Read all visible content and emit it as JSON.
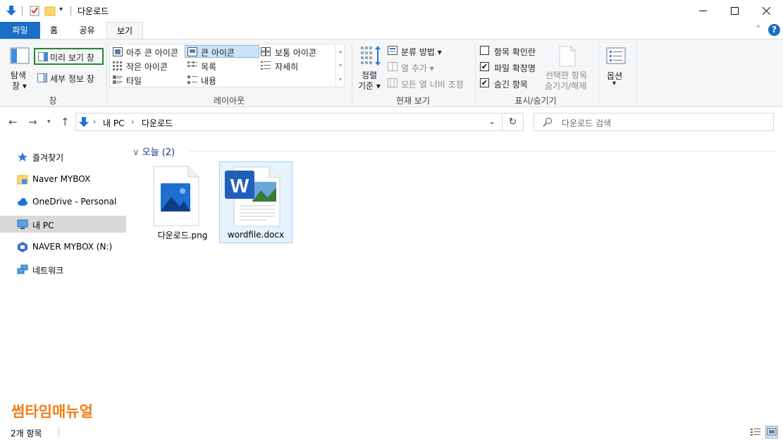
{
  "window": {
    "title": "다운로드"
  },
  "ribbon_tabs": [
    "파일",
    "홈",
    "공유",
    "보기"
  ],
  "ribbon": {
    "pane": {
      "nav_pane_label_1": "탐색",
      "nav_pane_label_2": "창 ▾",
      "preview_pane": "미리 보기 창",
      "details_pane": "세부 정보 창",
      "group_label": "창"
    },
    "layout": {
      "items": [
        "아주 큰 아이콘",
        "큰 아이콘",
        "보통 아이콘",
        "작은 아이콘",
        "목록",
        "자세히",
        "타일",
        "내용"
      ],
      "group_label": "레이아웃"
    },
    "current_view": {
      "sort_label_1": "정렬",
      "sort_label_2": "기준 ▾",
      "group_by": "분류 방법 ▾",
      "add_column": "열 추가 ▾",
      "fit_columns": "모든 열 너비 조정",
      "group_label": "현재 보기"
    },
    "show_hide": {
      "item_checkboxes": "항목 확인란",
      "file_extensions": "파일 확장명",
      "hidden_items": "숨긴 항목",
      "hide_selected_1": "선택한 항목",
      "hide_selected_2": "숨기기/해제",
      "group_label": "표시/숨기기",
      "checks": {
        "item_checkboxes": false,
        "file_extensions": true,
        "hidden_items": true
      }
    },
    "options": {
      "label_1": "옵션",
      "label_2": "▾"
    }
  },
  "address": {
    "path": [
      "내 PC",
      "다운로드"
    ],
    "search_placeholder": "다운로드 검색"
  },
  "sidebar": {
    "items": [
      {
        "label": "즐겨찾기",
        "icon": "star-icon"
      },
      {
        "label": "Naver MYBOX",
        "icon": "mybox-folder-icon"
      },
      {
        "label": "OneDrive - Personal",
        "icon": "cloud-icon"
      },
      {
        "label": "내 PC",
        "icon": "monitor-icon",
        "selected": true
      },
      {
        "label": "NAVER MYBOX (N:)",
        "icon": "mybox-drive-icon"
      },
      {
        "label": "네트워크",
        "icon": "network-icon"
      }
    ]
  },
  "content": {
    "group_header": "오늘 (2)",
    "files": [
      {
        "name": "다운로드.png",
        "icon": "image-file-icon"
      },
      {
        "name": "wordfile.docx",
        "icon": "word-file-icon",
        "selected": true
      }
    ]
  },
  "watermark": "썸타임매뉴얼",
  "status": {
    "count": "2개 항목"
  },
  "colors": {
    "accent": "#1a6ec6",
    "highlight_box": "#1e8a2e",
    "watermark": "#f07d16"
  }
}
